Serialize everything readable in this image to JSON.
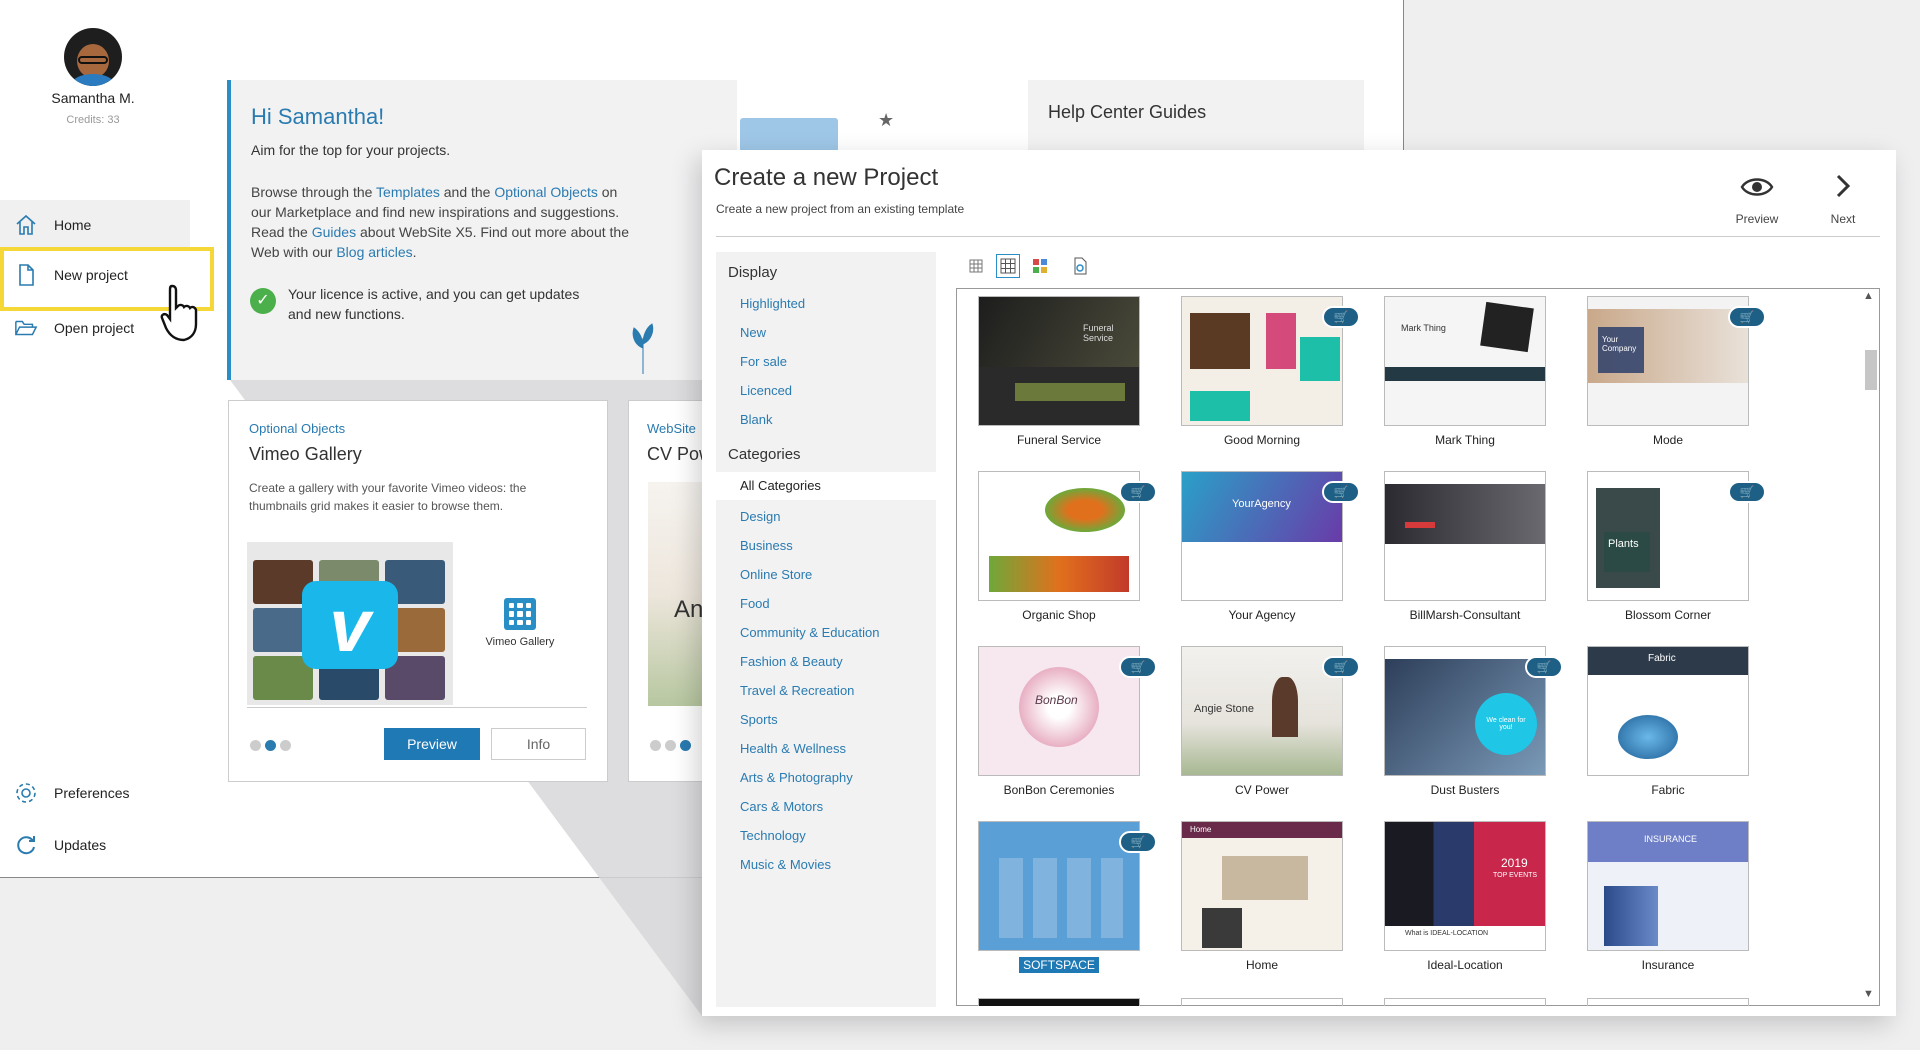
{
  "user": {
    "name": "Samantha M.",
    "credits": "Credits: 33"
  },
  "nav": {
    "home": "Home",
    "new_project": "New project",
    "open_project": "Open project",
    "preferences": "Preferences",
    "updates": "Updates"
  },
  "welcome": {
    "title": "Hi Samantha!",
    "subtitle": "Aim for the top for your projects.",
    "p1": "Browse through the ",
    "templates_link": "Templates",
    "p2": " and the ",
    "optional_link": "Optional Objects",
    "p3": " on our Marketplace and find new inspirations and suggestions. Read the ",
    "guides_link": "Guides",
    "p4": " about WebSite X5. Find out more about the Web with our ",
    "blog_link": "Blog articles",
    "p5": ".",
    "licence": "Your licence is active, and you can get updates and new functions."
  },
  "help": {
    "title": "Help Center Guides"
  },
  "card1": {
    "tag": "Optional Objects",
    "title": "Vimeo Gallery",
    "desc": "Create a gallery with your favorite Vimeo videos: the thumbnails grid makes it easier to browse them.",
    "icon_label": "Vimeo Gallery",
    "preview": "Preview",
    "info": "Info"
  },
  "card2": {
    "tag": "WebSite",
    "title": "CV Pow",
    "img_text": "An"
  },
  "modal": {
    "title": "Create a new Project",
    "subtitle": "Create a new project from an existing template",
    "preview": "Preview",
    "next": "Next",
    "display_header": "Display",
    "display_items": [
      "Highlighted",
      "New",
      "For sale",
      "Licenced",
      "Blank"
    ],
    "categories_header": "Categories",
    "categories": [
      "All Categories",
      "Design",
      "Business",
      "Online Store",
      "Food",
      "Community & Education",
      "Fashion & Beauty",
      "Travel & Recreation",
      "Sports",
      "Health & Wellness",
      "Arts & Photography",
      "Cars & Motors",
      "Technology",
      "Music & Movies"
    ],
    "selected_category": "All Categories"
  },
  "templates": [
    {
      "name": "Funeral Service",
      "cart": false,
      "bg": "#2a2a2a",
      "accent": "#6b7a3a"
    },
    {
      "name": "Good Morning",
      "cart": true,
      "bg": "#f3efe6",
      "accent": "#1dbfa8"
    },
    {
      "name": "Mark Thing",
      "cart": false,
      "bg": "#f5f5f5",
      "accent": "#233a45"
    },
    {
      "name": "Mode",
      "cart": true,
      "bg": "#f3f3f3",
      "accent": "#2d3f6b"
    },
    {
      "name": "Organic Shop",
      "cart": true,
      "bg": "#ffffff",
      "accent": "#e1701d"
    },
    {
      "name": "Your Agency",
      "cart": true,
      "bg": "#3a5fb0",
      "accent": "#6a3aa8"
    },
    {
      "name": "BillMarsh-Consultant",
      "cart": false,
      "bg": "#3b3b44",
      "accent": "#d63a3a"
    },
    {
      "name": "Blossom Corner",
      "cart": true,
      "bg": "#ffffff",
      "accent": "#2b4a45"
    },
    {
      "name": "BonBon Ceremonies",
      "cart": true,
      "bg": "#f6e8ee",
      "accent": "#d07a9a"
    },
    {
      "name": "CV Power",
      "cart": true,
      "bg": "#e9e7e2",
      "accent": "#9aa886"
    },
    {
      "name": "Dust Busters",
      "cart": true,
      "bg": "#3a5a80",
      "accent": "#1fc6e6"
    },
    {
      "name": "Fabric",
      "cart": false,
      "bg": "#2d4f72",
      "accent": "#1e7fc0"
    },
    {
      "name": "SOFTSPACE",
      "cart": true,
      "bg": "#5a9fd6",
      "accent": "#3d7fb8",
      "selected": true
    },
    {
      "name": "Home",
      "cart": false,
      "bg": "#f5f0e8",
      "accent": "#6a2a4a"
    },
    {
      "name": "Ideal-Location",
      "cart": false,
      "bg": "#2a3a6a",
      "accent": "#c8264a"
    },
    {
      "name": "Insurance",
      "cart": false,
      "bg": "#eef1f8",
      "accent": "#6e7fc8"
    }
  ],
  "template_text": {
    "funeral": "Funeral Service",
    "mark_thing": "Mark Thing",
    "mode": "Your Company",
    "your_agency": "YourAgency",
    "plants": "Plants",
    "bonbon": "BonBon",
    "cvpower": "Angie Stone",
    "dust": "We clean for you!",
    "fabric": "Fabric",
    "home": "Home",
    "ideal_year": "2019",
    "ideal_sub": "TOP EVENTS",
    "ideal_what": "What is IDEAL-LOCATION",
    "insurance": "INSURANCE"
  },
  "colors": {
    "accent": "#2a7bb0",
    "highlight": "#f5d738",
    "button": "#1f79b4",
    "cart": "#1e5f86"
  }
}
